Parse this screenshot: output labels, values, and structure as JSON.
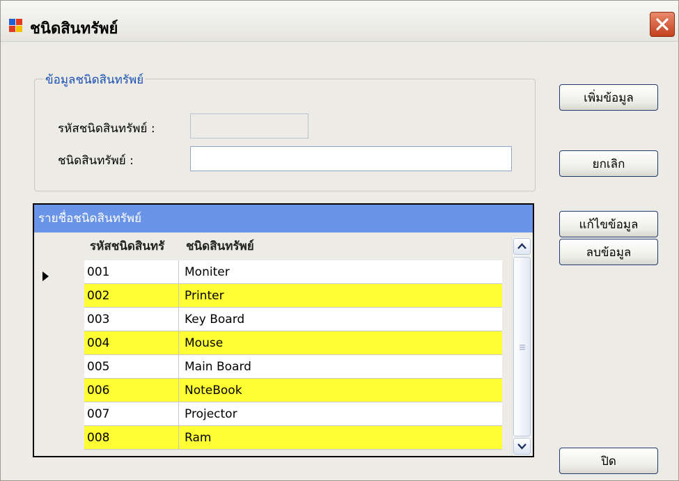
{
  "window": {
    "title": "ชนิดสินทรัพย์"
  },
  "group": {
    "legend": "ข้อมูลชนิดสินทรัพย์",
    "code_label": "รหัสชนิดสินทรัพย์ :",
    "code_value": "",
    "name_label": "ชนิดสินทรัพย์ :",
    "name_value": ""
  },
  "buttons": {
    "add": "เพิ่มข้อมูล",
    "cancel": "ยกเลิก",
    "edit": "แก้ไขข้อมูล",
    "delete": "ลบข้อมูล",
    "close": "ปิด"
  },
  "grid": {
    "caption": "รายชื่อชนิดสินทรัพย์",
    "columns": [
      "รหัสชนิดสินทรั",
      "ชนิดสินทรัพย์"
    ],
    "rows": [
      {
        "id": "001",
        "name": "Moniter"
      },
      {
        "id": "002",
        "name": "Printer"
      },
      {
        "id": "003",
        "name": "Key Board"
      },
      {
        "id": "004",
        "name": "Mouse"
      },
      {
        "id": "005",
        "name": "Main Board"
      },
      {
        "id": "006",
        "name": "NoteBook"
      },
      {
        "id": "007",
        "name": "Projector"
      },
      {
        "id": "008",
        "name": "Ram"
      }
    ]
  },
  "colors": {
    "caption_bg": "#6a94e8",
    "alt_row": "#ffff33",
    "row": "#ffffff",
    "legend_text": "#1a4fb3",
    "close_button": "#d4532f"
  },
  "icons": {
    "app": "form-icon",
    "close": "close-x-icon",
    "row_pointer": "triangle-right-icon",
    "scroll_up": "chevron-up-icon",
    "scroll_down": "chevron-down-icon"
  }
}
